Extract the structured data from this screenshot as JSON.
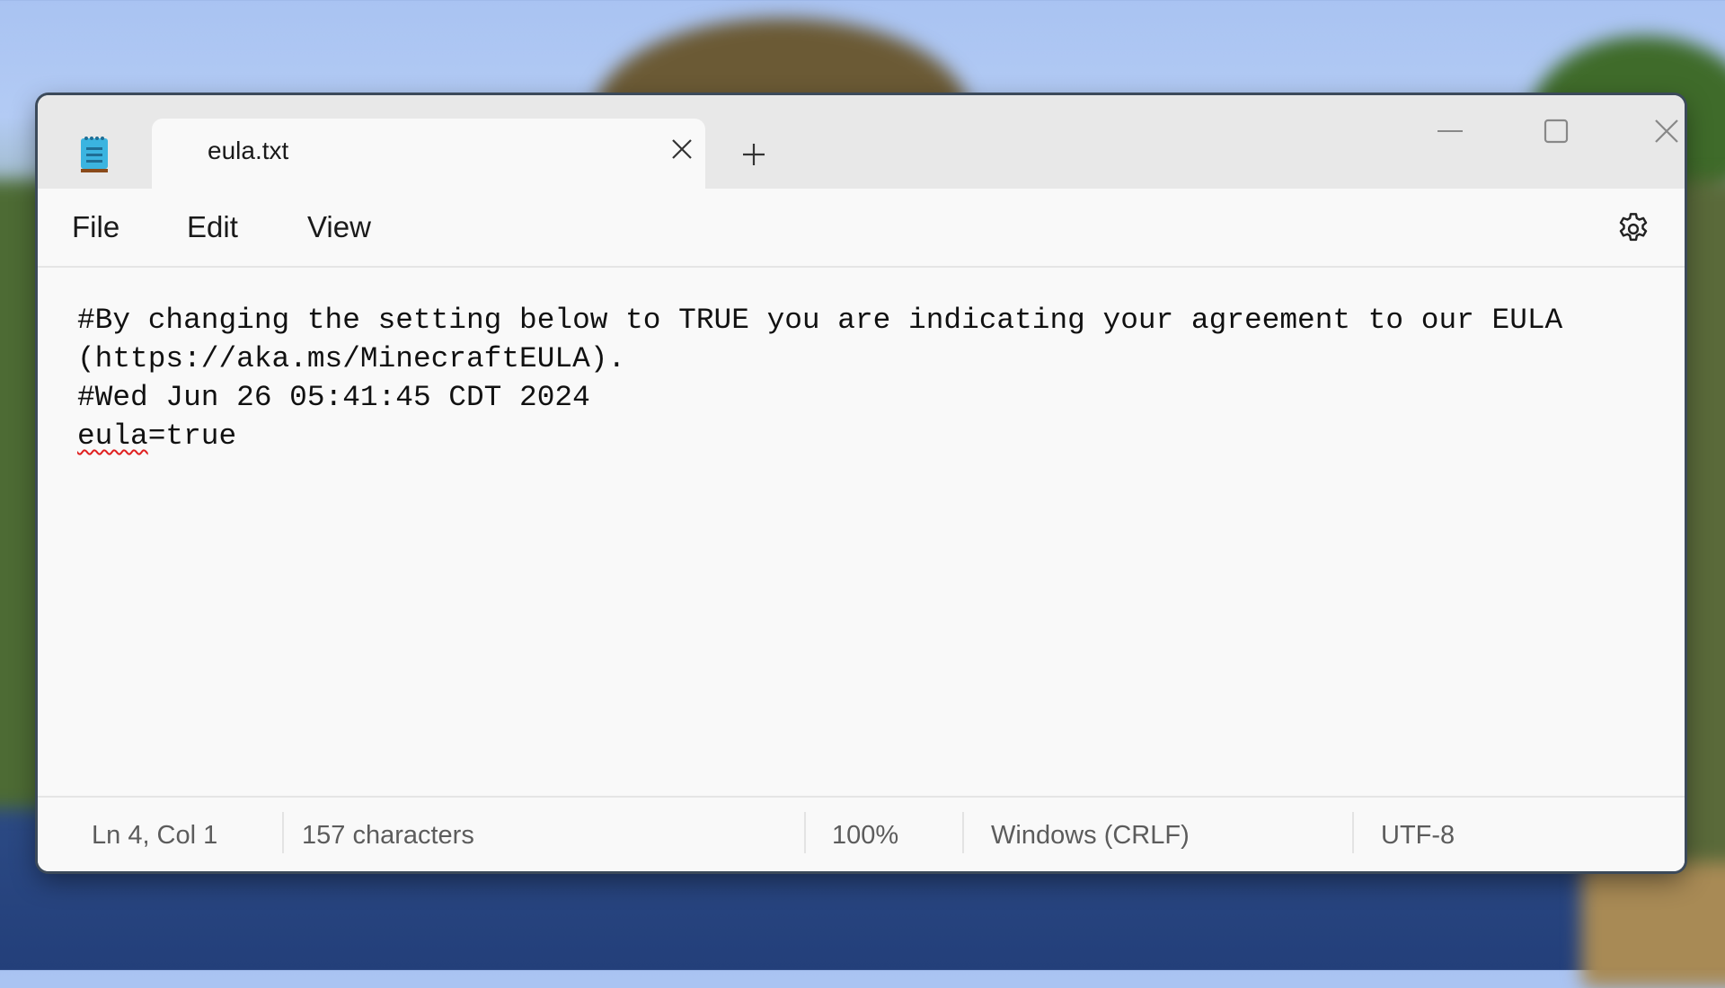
{
  "window": {
    "tab_title": "eula.txt",
    "icons": {
      "app": "notepad-icon",
      "tab_close": "close-icon",
      "new_tab": "plus-icon",
      "minimize": "minimize-icon",
      "maximize": "maximize-icon",
      "close": "close-icon",
      "settings": "gear-icon"
    }
  },
  "menu": {
    "items": [
      {
        "label": "File"
      },
      {
        "label": "Edit"
      },
      {
        "label": "View"
      }
    ]
  },
  "editor": {
    "lines": [
      "#By changing the setting below to TRUE you are indicating your agreement to our EULA",
      "(https://aka.ms/MinecraftEULA).",
      "#Wed Jun 26 05:41:45 CDT 2024",
      "eula=true"
    ],
    "line4_parts": {
      "misspelled": "eula",
      "rest": "=true"
    }
  },
  "status": {
    "position": "Ln 4, Col 1",
    "characters": "157 characters",
    "zoom": "100%",
    "line_ending": "Windows (CRLF)",
    "encoding": "UTF-8"
  },
  "colors": {
    "window_bg": "#f9f9f9",
    "titlebar_bg": "#e8e8e8",
    "spell_underline": "#e02020",
    "notepad_icon": "#3bb4e0"
  }
}
